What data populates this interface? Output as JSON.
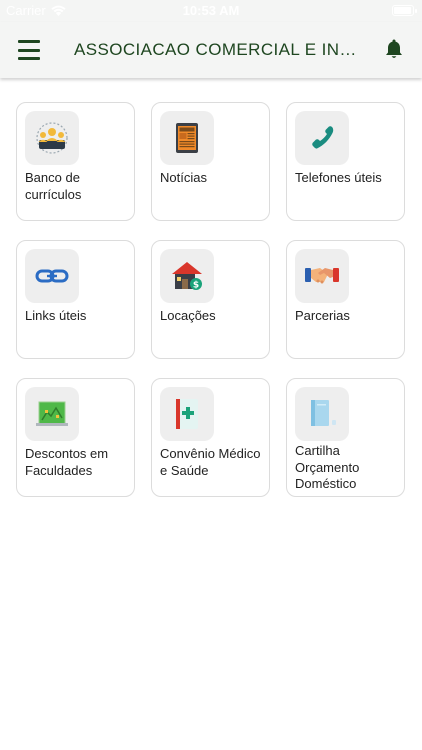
{
  "status_bar": {
    "carrier": "Carrier",
    "time": "10:53 AM"
  },
  "header": {
    "title": "ASSOCIACAO COMERCIAL E INDU...",
    "menu_icon": "hamburger-menu-icon",
    "notification_icon": "bell-icon"
  },
  "colors": {
    "brand_green": "#1e4620",
    "accent_teal": "#1a8c80",
    "card_border": "#dcdcdc",
    "icon_background": "#eeeeee"
  },
  "menu": {
    "items": [
      {
        "label": "Banco de currículos",
        "icon": "team-people-icon"
      },
      {
        "label": "Notícias",
        "icon": "news-tablet-icon"
      },
      {
        "label": "Telefones úteis",
        "icon": "phone-handset-icon"
      },
      {
        "label": "Links úteis",
        "icon": "chain-link-icon"
      },
      {
        "label": "Locações",
        "icon": "house-rent-icon"
      },
      {
        "label": "Parcerias",
        "icon": "handshake-icon"
      },
      {
        "label": "Descontos em Faculdades",
        "icon": "map-discount-icon"
      },
      {
        "label": "Convênio Médico e Saúde",
        "icon": "medical-plus-icon"
      },
      {
        "label": "Cartilha Orçamento Doméstico",
        "icon": "booklet-icon"
      }
    ]
  }
}
